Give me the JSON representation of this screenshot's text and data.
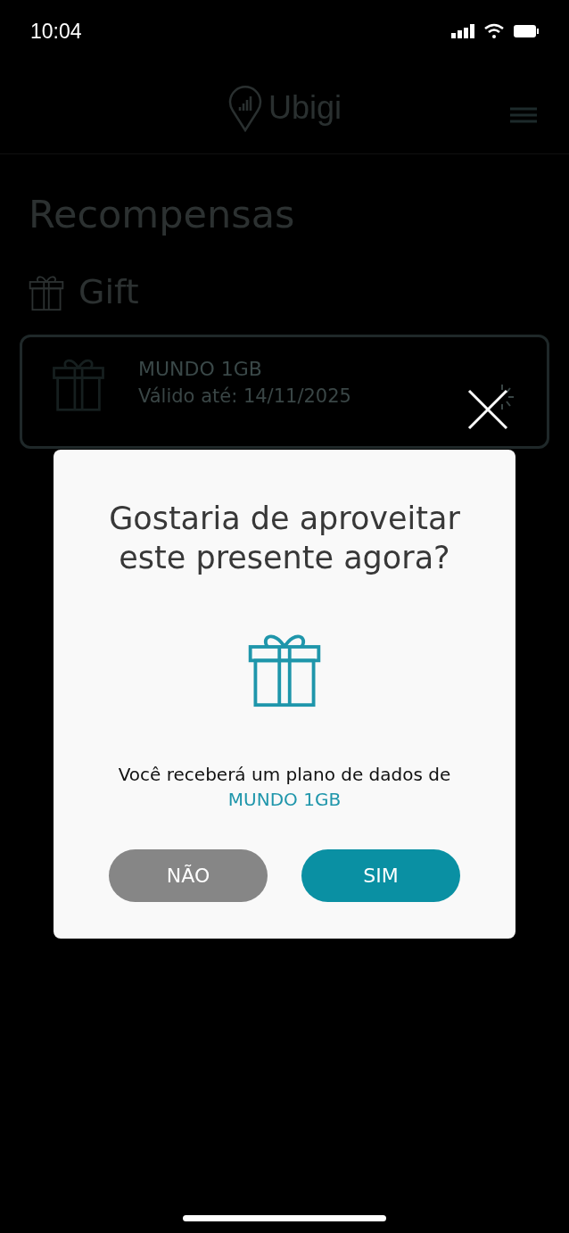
{
  "status_bar": {
    "time": "10:04"
  },
  "header": {
    "logo_text": "Ubigi"
  },
  "page": {
    "title": "Recompensas",
    "section": "Gift",
    "reward": {
      "name": "MUNDO 1GB",
      "validity": "Válido até: 14/11/2025"
    }
  },
  "dialog": {
    "title": "Gostaria de aproveitar este presente agora?",
    "message": "Você receberá um plano de dados de",
    "plan": "MUNDO 1GB",
    "buttons": [
      {
        "label": "NÃO",
        "kind": "secondary"
      },
      {
        "label": "SIM",
        "kind": "primary"
      }
    ]
  }
}
